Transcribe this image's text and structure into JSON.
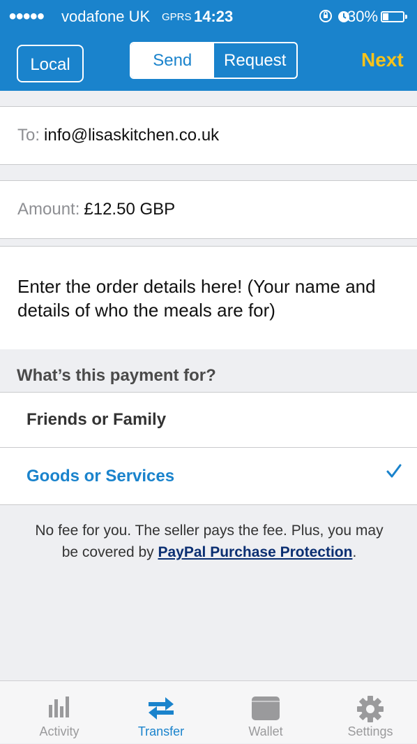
{
  "status_bar": {
    "signal_dots": "●●●●●",
    "carrier": "vodafone UK",
    "network": "GPRS",
    "time": "14:23",
    "right_icons": "⊕ ◔",
    "battery_percent": "30%",
    "battery_level": 0.3
  },
  "nav": {
    "local_label": "Local",
    "segments": [
      "Send",
      "Request"
    ],
    "active_segment": "Send",
    "next_label": "Next"
  },
  "form": {
    "to_label": "To:",
    "to_value": "info@lisaskitchen.co.uk",
    "amount_label": "Amount:",
    "amount_value": "£12.50 GBP",
    "note_text": "Enter the order details here! (Your name and details of who the meals are for)"
  },
  "payment_for": {
    "heading": "What’s this payment for?",
    "options": [
      {
        "label": "Friends or Family",
        "selected": false
      },
      {
        "label": "Goods or Services",
        "selected": true
      }
    ],
    "info_text": "No fee for you. The seller pays the fee. Plus, you may be covered by ",
    "info_link": "PayPal Purchase Protection",
    "info_end": "."
  },
  "tabs": [
    {
      "label": "Activity",
      "icon": "activity-bars-icon"
    },
    {
      "label": "Transfer",
      "icon": "transfer-arrows-icon",
      "active": true
    },
    {
      "label": "Wallet",
      "icon": "wallet-icon"
    },
    {
      "label": "Settings",
      "icon": "gear-icon"
    }
  ],
  "colors": {
    "brand_blue": "#1a83cc",
    "next_yellow": "#f7c31b",
    "link_navy": "#0b2f72",
    "tab_gray": "#9a9a9c"
  }
}
